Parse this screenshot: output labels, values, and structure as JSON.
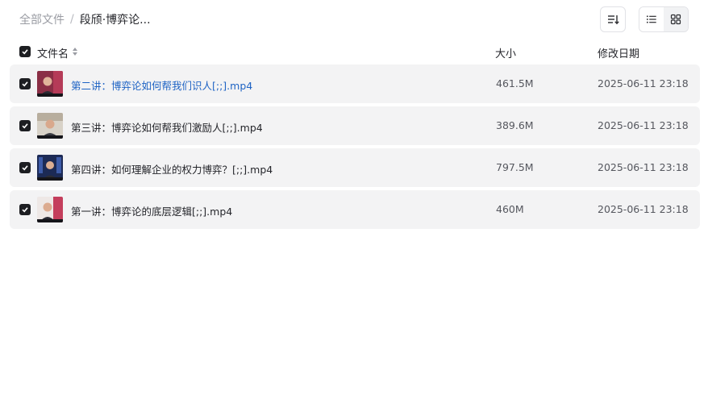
{
  "breadcrumb": {
    "root": "全部文件",
    "separator": "/",
    "current": "段颀·博弈论..."
  },
  "toolbar": {
    "sort_icon": "sort-lines-icon",
    "list_view_icon": "list-view-icon",
    "grid_view_icon": "grid-view-icon",
    "active_view": "list"
  },
  "table": {
    "columns": {
      "name": "文件名",
      "size": "大小",
      "modified": "修改日期"
    },
    "rows": [
      {
        "name": "第二讲：博弈论如何帮我们识人[;;].mp4",
        "size": "461.5M",
        "modified": "2025-06-11 23:18",
        "selected": true,
        "highlight": true
      },
      {
        "name": "第三讲：博弈论如何帮我们激励人[;;].mp4",
        "size": "389.6M",
        "modified": "2025-06-11 23:18",
        "selected": true,
        "highlight": false
      },
      {
        "name": "第四讲：如何理解企业的权力博弈？[;;].mp4",
        "size": "797.5M",
        "modified": "2025-06-11 23:18",
        "selected": true,
        "highlight": false
      },
      {
        "name": "第一讲：博弈论的底层逻辑[;;].mp4",
        "size": "460M",
        "modified": "2025-06-11 23:18",
        "selected": true,
        "highlight": false
      }
    ]
  },
  "colors": {
    "highlight_text": "#1e63c4",
    "row_background": "#f3f3f4",
    "checkbox": "#1d1e22"
  }
}
